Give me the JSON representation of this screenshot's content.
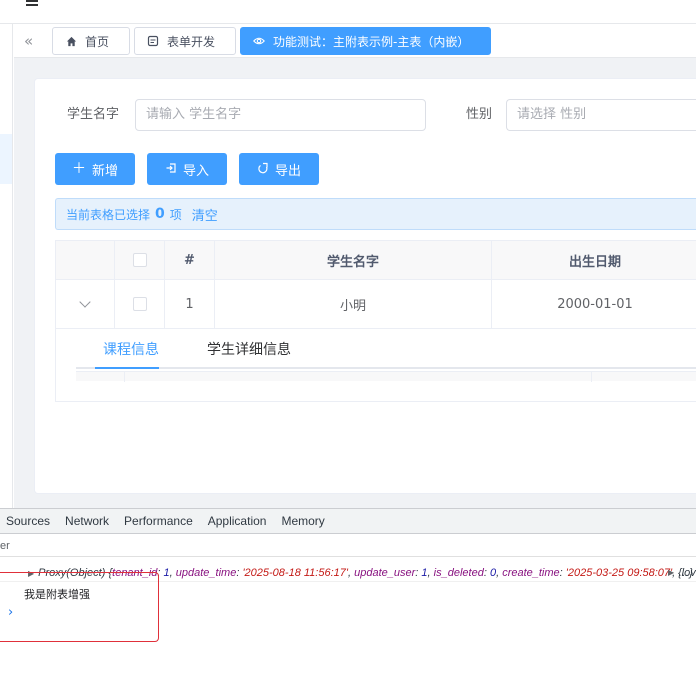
{
  "tags": {
    "home": "首页",
    "form_dev": "表单开发",
    "active": "功能测试：主附表示例-主表（内嵌）"
  },
  "search_form": {
    "name_label": "学生名字",
    "name_placeholder": "请输入 学生名字",
    "gender_label": "性别",
    "gender_placeholder": "请选择 性别"
  },
  "toolbar": {
    "add_label": "新增",
    "import_label": "导入",
    "export_label": "导出"
  },
  "selection": {
    "prefix": "当前表格已选择",
    "count": "0",
    "suffix": "项",
    "clear_label": "清空"
  },
  "table": {
    "headers": [
      "#",
      "学生名字",
      "出生日期"
    ],
    "rows": [
      {
        "index": "1",
        "name": "小明",
        "birth_date": "2000-01-01"
      }
    ]
  },
  "sub_tabs": [
    "课程信息",
    "学生详细信息"
  ],
  "devtools": {
    "tabs": [
      "Sources",
      "Network",
      "Performance",
      "Application",
      "Memory"
    ],
    "filter_text": "er",
    "log_object": {
      "label": "Proxy(Object)",
      "k1": "tenant_id",
      "v1": "1",
      "k2": "update_time",
      "v2": "'2025-08-18 11:56:17'",
      "k3": "update_user",
      "v3": "1",
      "k4": "is_deleted",
      "v4": "0",
      "k5": "create_time",
      "v5": "'2025-03-25 09:58:07'",
      "tail": ", …}",
      "next": "{lov"
    },
    "log_message": "我是附表增强",
    "prompt": "›"
  },
  "colors": {
    "primary": "#409eff",
    "highlight_border": "#e0303a"
  }
}
